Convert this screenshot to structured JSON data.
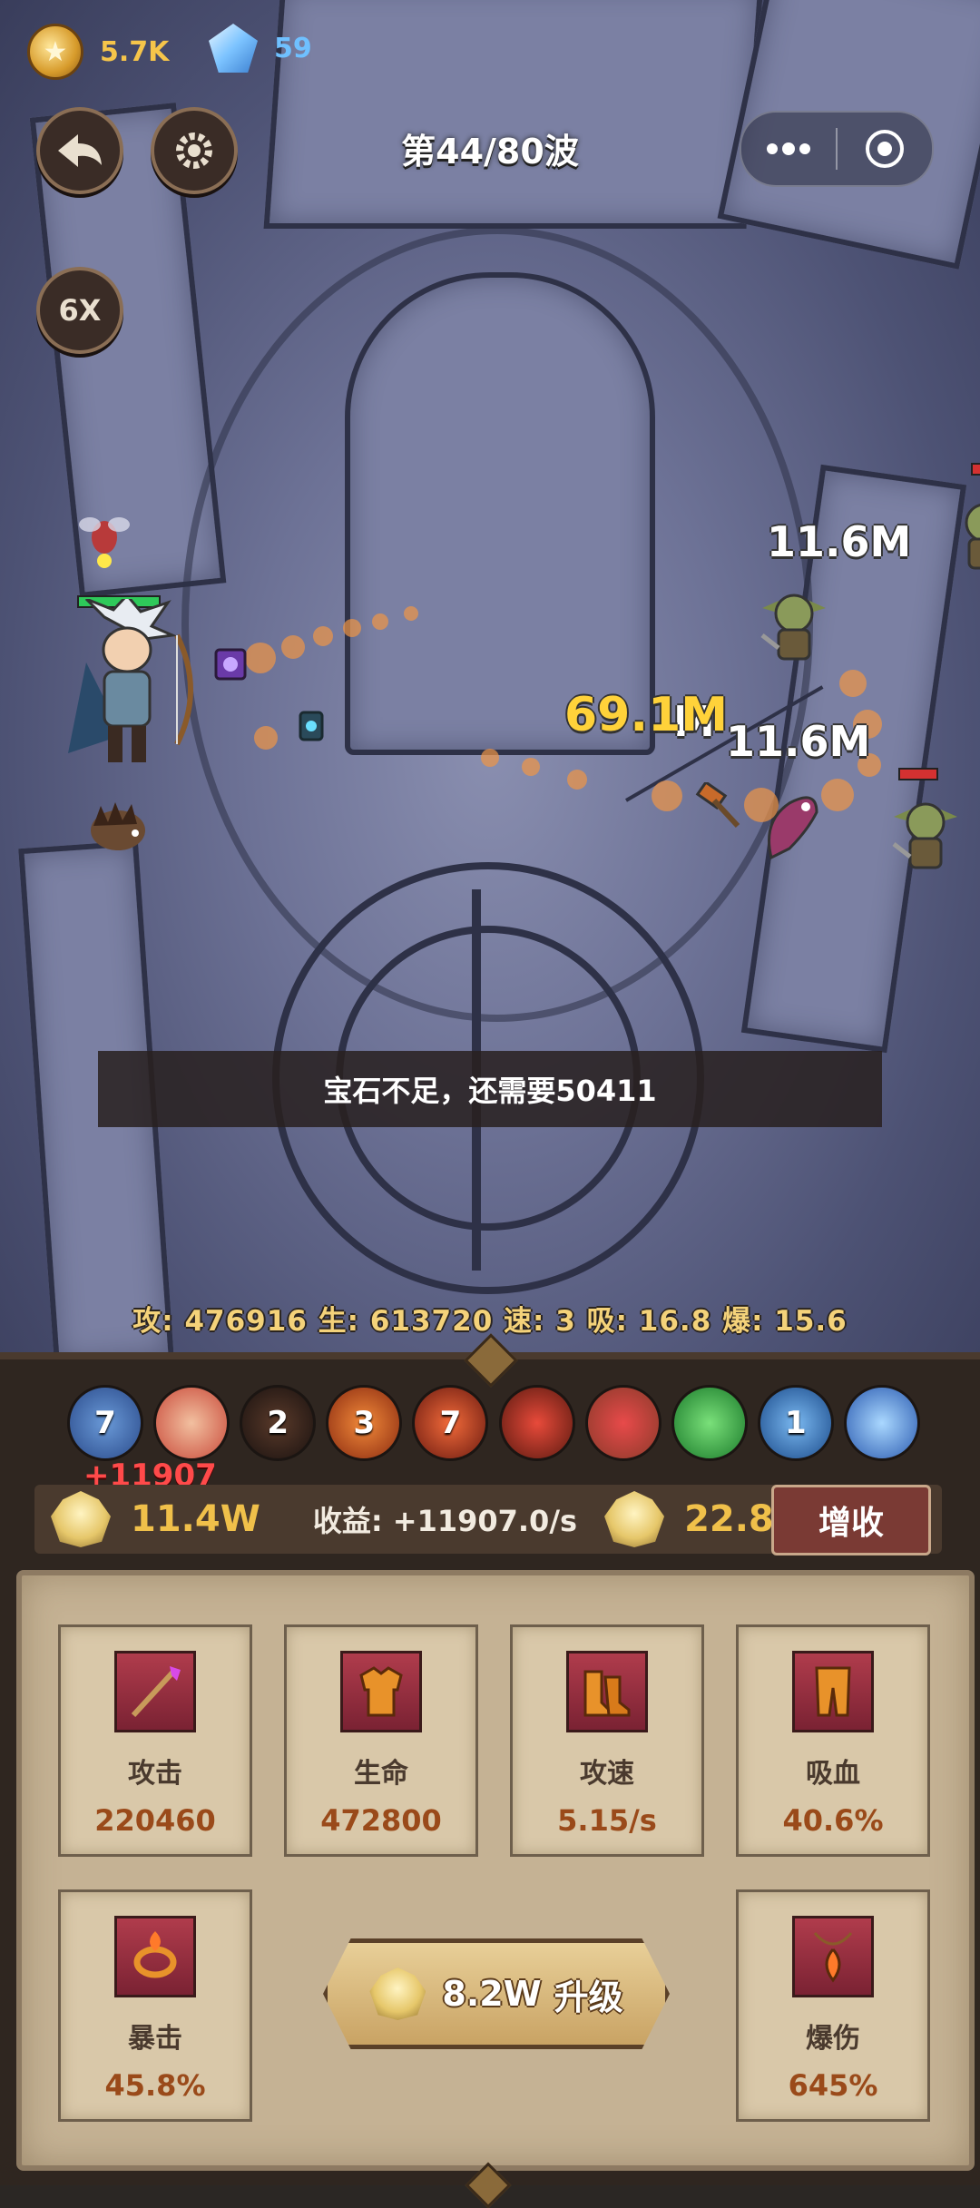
{
  "resources": {
    "coins": "5.7K",
    "gems": "59"
  },
  "header": {
    "wave": "第44/80波",
    "speed": "6X"
  },
  "damage_numbers": [
    "11.6M",
    "11.6M",
    "69.1M",
    "M"
  ],
  "toast": "宝石不足，还需要50411",
  "stats_line": "攻: 476916  生: 613720  速: 3  吸: 16.8  爆: 15.6",
  "skills": [
    {
      "name": "skill-1",
      "badge": "7",
      "color": "#3b5a9a"
    },
    {
      "name": "skill-2",
      "badge": "",
      "color": "#c94a3a"
    },
    {
      "name": "skill-3",
      "badge": "2",
      "color": "#2a1e1a"
    },
    {
      "name": "skill-4",
      "badge": "3",
      "color": "#b8501e"
    },
    {
      "name": "skill-5",
      "badge": "7",
      "color": "#a83020"
    },
    {
      "name": "skill-6",
      "badge": "",
      "color": "#9a2a20"
    },
    {
      "name": "skill-7",
      "badge": "",
      "color": "#b83a2a"
    },
    {
      "name": "skill-8",
      "badge": "",
      "color": "#3aa040"
    },
    {
      "name": "skill-9",
      "badge": "1",
      "color": "#2a6ab0"
    },
    {
      "name": "skill-10",
      "badge": "",
      "color": "#3a7ad0"
    }
  ],
  "economy": {
    "gain_popup": "+11907",
    "stone_left": "11.4W",
    "income": "收益: +11907.0/s",
    "stone_right": "22.8W",
    "increase_button": "增收"
  },
  "cards": [
    {
      "label": "攻击",
      "value": "220460",
      "icon": "staff-icon"
    },
    {
      "label": "生命",
      "value": "472800",
      "icon": "armor-icon"
    },
    {
      "label": "攻速",
      "value": "5.15/s",
      "icon": "boots-icon"
    },
    {
      "label": "吸血",
      "value": "40.6%",
      "icon": "leggings-icon"
    },
    {
      "label": "暴击",
      "value": "45.8%",
      "icon": "ring-icon"
    },
    {
      "label": "爆伤",
      "value": "645%",
      "icon": "amulet-icon"
    }
  ],
  "upgrade": {
    "cost": "8.2W",
    "label": "升级"
  }
}
